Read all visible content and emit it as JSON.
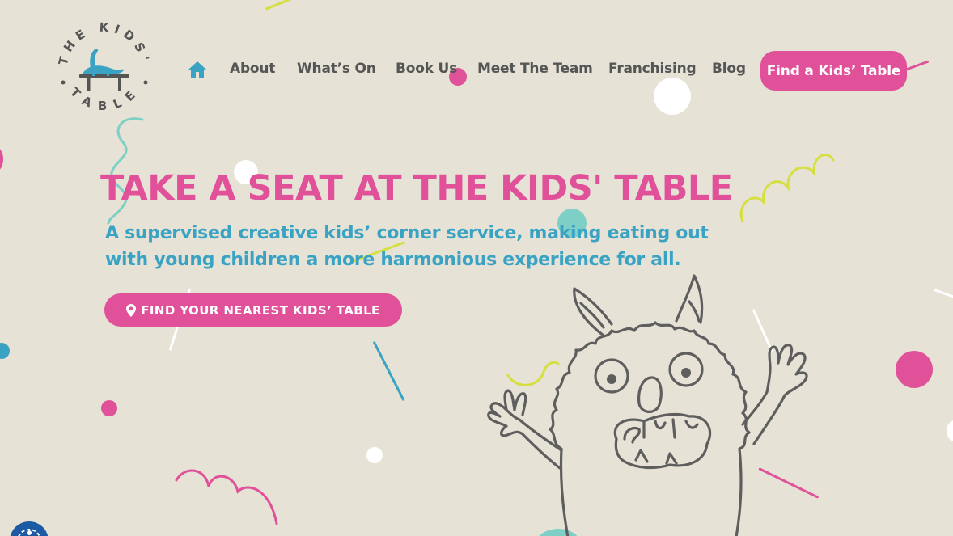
{
  "brand": {
    "logo_text_top": "THE KIDS'",
    "logo_text_bottom": "TABLE"
  },
  "nav": {
    "home_icon": "home-icon",
    "items": [
      "About",
      "What’s On",
      "Book Us",
      "Meet The Team",
      "Franchising",
      "Blog"
    ],
    "cta": "Find a Kids’ Table"
  },
  "hero": {
    "title": "TAKE A SEAT AT THE KIDS' TABLE",
    "subtitle": "A supervised creative kids’ corner service, making eating out with young children a more harmonious experience for all.",
    "button": "FIND YOUR NEAREST KIDS’ TABLE",
    "button_icon": "map-pin-icon"
  },
  "accessibility_widget": {
    "icon": "accessibility-icon"
  },
  "colors": {
    "background": "#e6e2d6",
    "pink": "#e0519a",
    "teal": "#3aa3c4",
    "mint": "#7ecfc6",
    "lime": "#d6df3f",
    "nav_text": "#555555"
  }
}
